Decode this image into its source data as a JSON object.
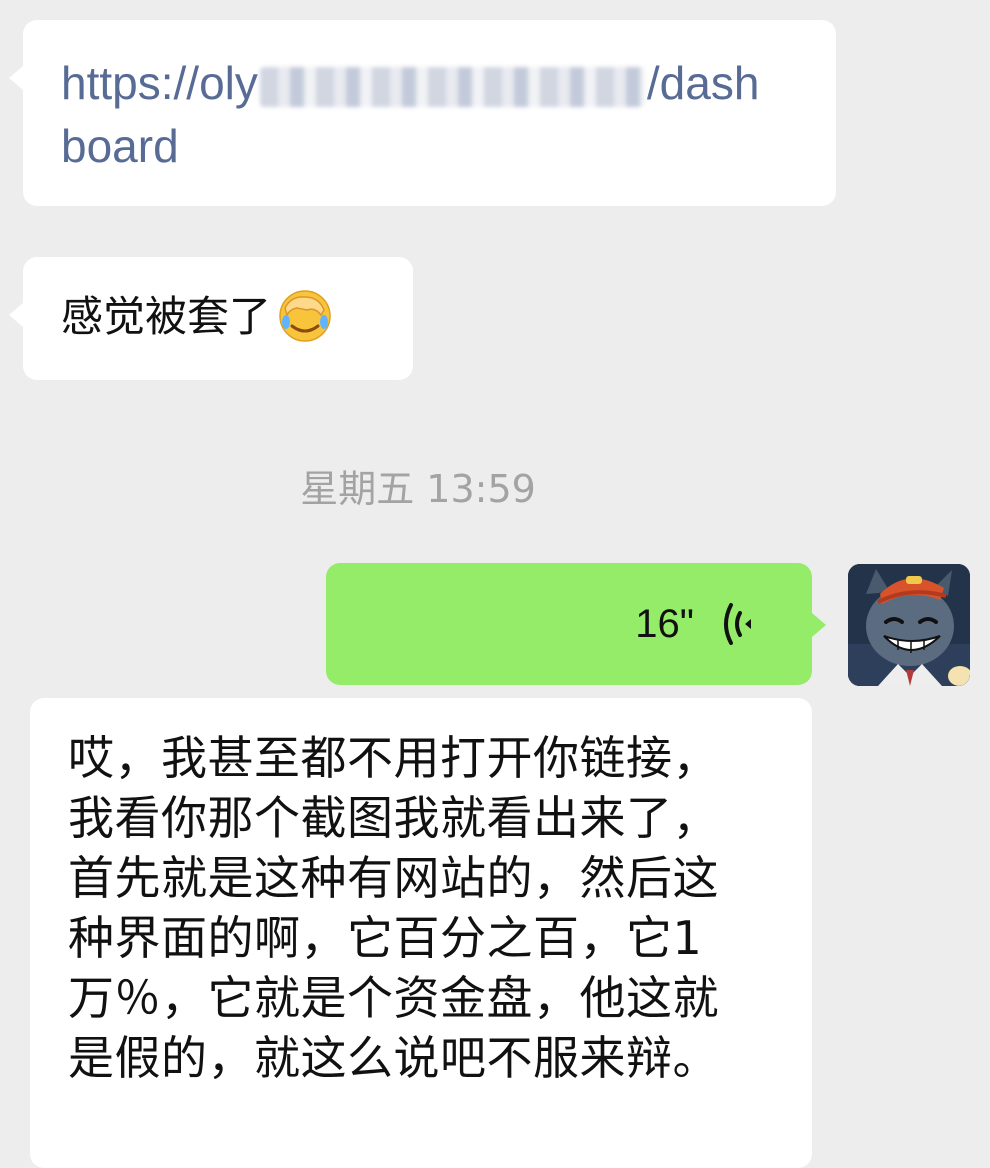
{
  "messages": {
    "link": {
      "text_start": "https://oly",
      "text_end": "/dash",
      "text_line2": "board"
    },
    "text1": {
      "text": "感觉被套了",
      "emoji": "facepalm-emoji"
    },
    "timestamp": "星期五 13:59",
    "voice": {
      "duration": "16\"",
      "icon": "voice-wave-icon",
      "bubble_color": "#95ec69"
    },
    "avatar": {
      "icon": "cartoon-wolf-avatar"
    },
    "text2": {
      "line1": "哎，我甚至都不用打开你链接，",
      "line2": "我看你那个截图我就看出来了，",
      "line3": "首先就是这种有网站的，然后这",
      "line4": "种界面的啊，它百分之百，它1",
      "line5": "万％，它就是个资金盘，他这就",
      "line6": "是假的，就这么说吧不服来辩。"
    }
  },
  "colors": {
    "background": "#ededed",
    "incoming_bubble": "#ffffff",
    "link_color": "#576b95",
    "timestamp_color": "#a3a3a3"
  }
}
